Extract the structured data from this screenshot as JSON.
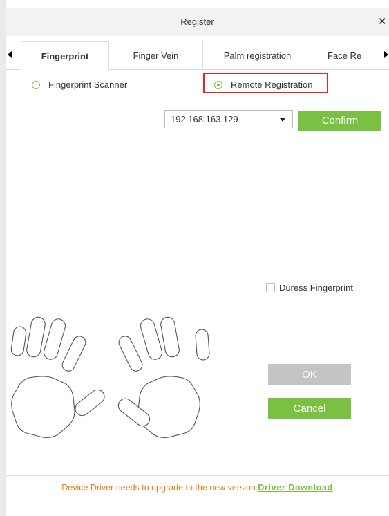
{
  "dialog": {
    "title": "Register",
    "close_symbol": "✕"
  },
  "tabs": [
    {
      "label": "Fingerprint",
      "active": true
    },
    {
      "label": "Finger Vein",
      "active": false
    },
    {
      "label": "Palm registration",
      "active": false
    },
    {
      "label": "Face Re",
      "active": false
    }
  ],
  "mode": {
    "scanner_label": "Fingerprint Scanner",
    "remote_label": "Remote Registration",
    "selected": "Remote Registration"
  },
  "device": {
    "ip_value": "192.168.163.129",
    "confirm_label": "Confirm"
  },
  "duress": {
    "label": "Duress Fingerprint",
    "checked": false
  },
  "actions": {
    "ok_label": "OK",
    "cancel_label": "Cancel"
  },
  "footer": {
    "message": "Device Driver needs to upgrade to the new version:",
    "link": "Driver Download"
  },
  "colors": {
    "accent": "#7ac143",
    "highlight": "#e8241f",
    "warning_text": "#f07c1a",
    "disabled": "#c4c4c4"
  }
}
